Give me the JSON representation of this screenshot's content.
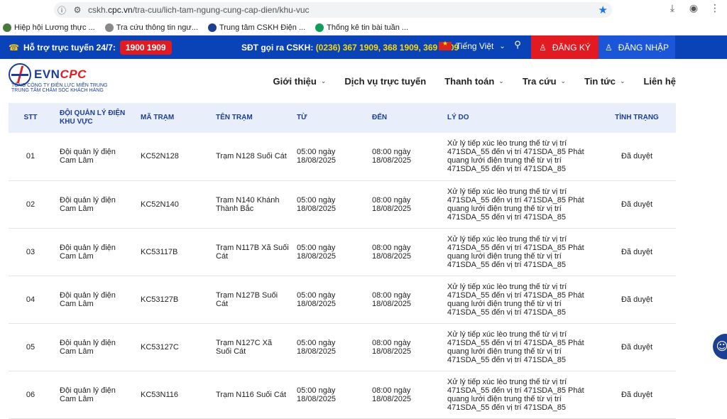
{
  "browser": {
    "url_prefix": "cskh.",
    "url_domain": "cpc.vn",
    "url_path": "/tra-cuu/lich-tam-ngung-cung-cap-dien/khu-vuc",
    "bookmarks": [
      {
        "label": "Hiệp hội Lương thực ...",
        "color": "#4a7a3a"
      },
      {
        "label": "Tra cứu thông tin ngư...",
        "color": "#888888"
      },
      {
        "label": "Trung tâm CSKH Điện ...",
        "color": "#1c3f94"
      },
      {
        "label": "Thống kê tin bài tuần ...",
        "color": "#0f9d58"
      }
    ]
  },
  "topbar": {
    "hotline_label": "Hỗ trợ trực tuyến 24/7:",
    "hotline_number": "1900 1909",
    "cskh_label": "SĐT gọi ra CSKH:",
    "cskh_numbers": "(0236) 367 1909, 368 1909, 369 1909",
    "language": "Tiếng Việt",
    "register": "ĐĂNG KÝ",
    "login": "ĐĂNG NHẬP"
  },
  "header": {
    "brand_a": "EVN",
    "brand_b": "CPC",
    "sub1": "TỔNG CÔNG TY ĐIỆN LỰC MIỀN TRUNG",
    "sub2": "TRUNG TÂM CHĂM SÓC KHÁCH HÀNG",
    "nav": [
      {
        "label": "Giới thiệu",
        "dropdown": true
      },
      {
        "label": "Dịch vụ trực tuyến",
        "dropdown": false
      },
      {
        "label": "Thanh toán",
        "dropdown": true
      },
      {
        "label": "Tra cứu",
        "dropdown": true
      },
      {
        "label": "Tin tức",
        "dropdown": true
      },
      {
        "label": "Liên hệ",
        "dropdown": false
      }
    ]
  },
  "table": {
    "headers": [
      "STT",
      "ĐỘI QUẢN LÝ ĐIỆN KHU VỰC",
      "MÃ TRẠM",
      "TÊN TRẠM",
      "TỪ",
      "ĐẾN",
      "LÝ DO",
      "TÌNH TRẠNG"
    ],
    "rows": [
      [
        "01",
        "Đội quản lý điện Cam Lâm",
        "KC52N128",
        "Trạm N128 Suối Cát",
        "05:00 ngày 18/08/2025",
        "08:00 ngày 18/08/2025",
        "Xử lý tiếp xúc lèo trung thế từ vị trí 471SDA_55 đến vị trí 471SDA_85 Phát quang lưới điện trung thế từ vị trí 471SDA_55 đến vị trí 471SDA_85",
        "Đã duyệt"
      ],
      [
        "02",
        "Đội quản lý điện Cam Lâm",
        "KC52N140",
        "Trạm N140 Khánh Thành Bắc",
        "05:00 ngày 18/08/2025",
        "08:00 ngày 18/08/2025",
        "Xử lý tiếp xúc lèo trung thế từ vị trí 471SDA_55 đến vị trí 471SDA_85 Phát quang lưới điện trung thế từ vị trí 471SDA_55 đến vị trí 471SDA_85",
        "Đã duyệt"
      ],
      [
        "03",
        "Đội quản lý điện Cam Lâm",
        "KC53117B",
        "Trạm N117B Xã Suối Cát",
        "05:00 ngày 18/08/2025",
        "08:00 ngày 18/08/2025",
        "Xử lý tiếp xúc lèo trung thế từ vị trí 471SDA_55 đến vị trí 471SDA_85 Phát quang lưới điện trung thế từ vị trí 471SDA_55 đến vị trí 471SDA_85",
        "Đã duyệt"
      ],
      [
        "04",
        "Đội quản lý điện Cam Lâm",
        "KC53127B",
        "Trạm N127B Suối Cát",
        "05:00 ngày 18/08/2025",
        "08:00 ngày 18/08/2025",
        "Xử lý tiếp xúc lèo trung thế từ vị trí 471SDA_55 đến vị trí 471SDA_85 Phát quang lưới điện trung thế từ vị trí 471SDA_55 đến vị trí 471SDA_85",
        "Đã duyệt"
      ],
      [
        "05",
        "Đội quản lý điện Cam Lâm",
        "KC53127C",
        "Trạm N127C Xã Suối Cát",
        "05:00 ngày 18/08/2025",
        "08:00 ngày 18/08/2025",
        "Xử lý tiếp xúc lèo trung thế từ vị trí 471SDA_55 đến vị trí 471SDA_85 Phát quang lưới điện trung thế từ vị trí 471SDA_55 đến vị trí 471SDA_85",
        "Đã duyệt"
      ],
      [
        "06",
        "Đội quản lý điện Cam Lâm",
        "KC53N116",
        "Trạm N116 Suối Cát",
        "05:00 ngày 18/08/2025",
        "08:00 ngày 18/08/2025",
        "Xử lý tiếp xúc lèo trung thế từ vị trí 471SDA_55 đến vị trí 471SDA_85 Phát quang lưới điện trung thế từ vị trí 471SDA_55 đến vị trí 471SDA_85",
        "Đã duyệt"
      ]
    ]
  }
}
